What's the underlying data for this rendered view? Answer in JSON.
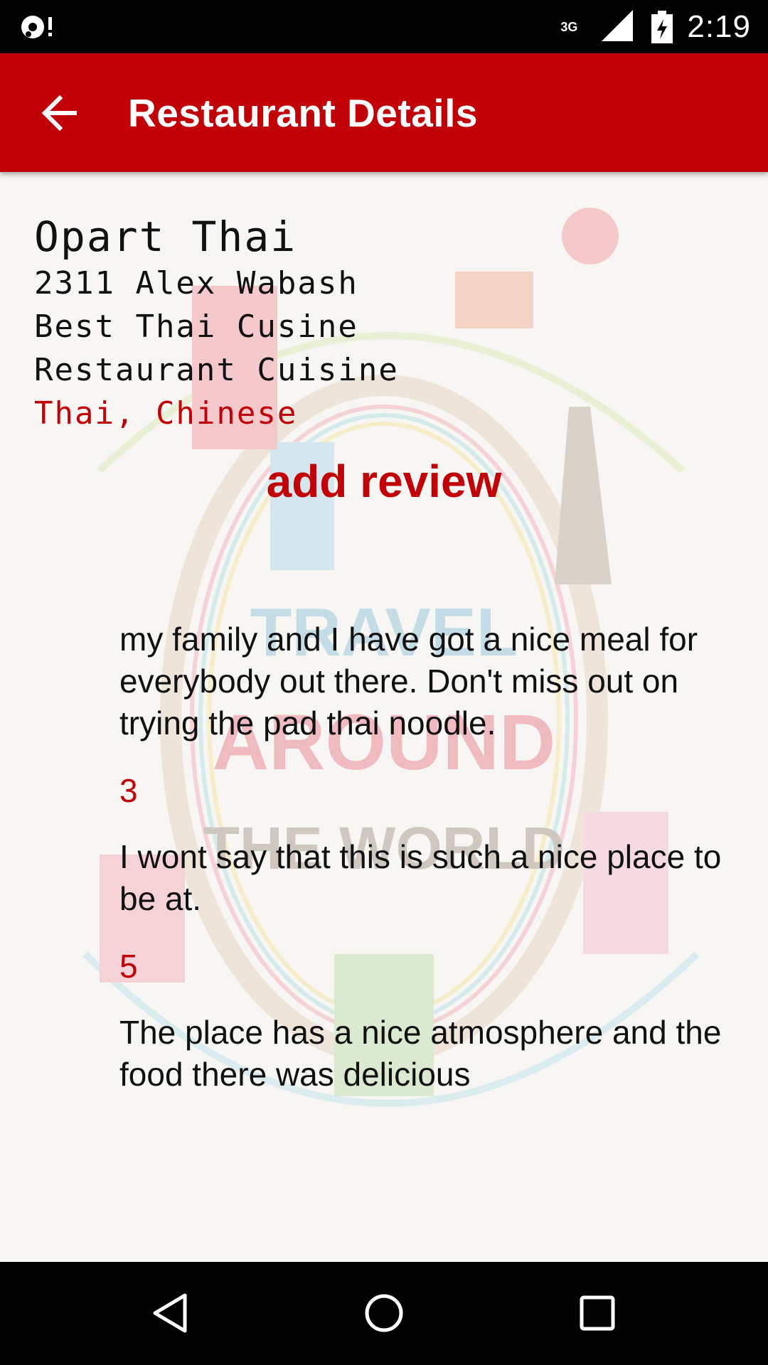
{
  "status_bar": {
    "network_label": "3G",
    "time": "2:19",
    "icons": [
      "sync-icon",
      "signal-icon",
      "battery-charging-icon"
    ]
  },
  "app_bar": {
    "title": "Restaurant Details",
    "back_icon": "arrow-back-icon",
    "background_color": "#c10008"
  },
  "restaurant": {
    "name": "Opart Thai",
    "address": "2311 Alex Wabash",
    "description": "Best Thai Cusine",
    "cuisine_label": "Restaurant Cuisine",
    "cuisine_types": "Thai, Chinese"
  },
  "add_review_label": "add review",
  "reviews": [
    {
      "text": "my family and I have got a nice meal for everybody out there. Don't miss out on trying the pad thai noodle."
    },
    {
      "rating": "3",
      "text": "I wont say that this is such a nice place to be at."
    },
    {
      "rating": "5",
      "text": "The place has a nice atmosphere and the food there was delicious"
    }
  ],
  "background_art": {
    "lines": [
      "TRAVEL",
      "AROUND",
      "THE WORLD"
    ]
  },
  "nav_bar": {
    "back": "nav-back-icon",
    "home": "nav-home-icon",
    "recents": "nav-recents-icon"
  },
  "colors": {
    "accent": "#c10008",
    "text": "#111111",
    "background": "#f8f6f3"
  }
}
